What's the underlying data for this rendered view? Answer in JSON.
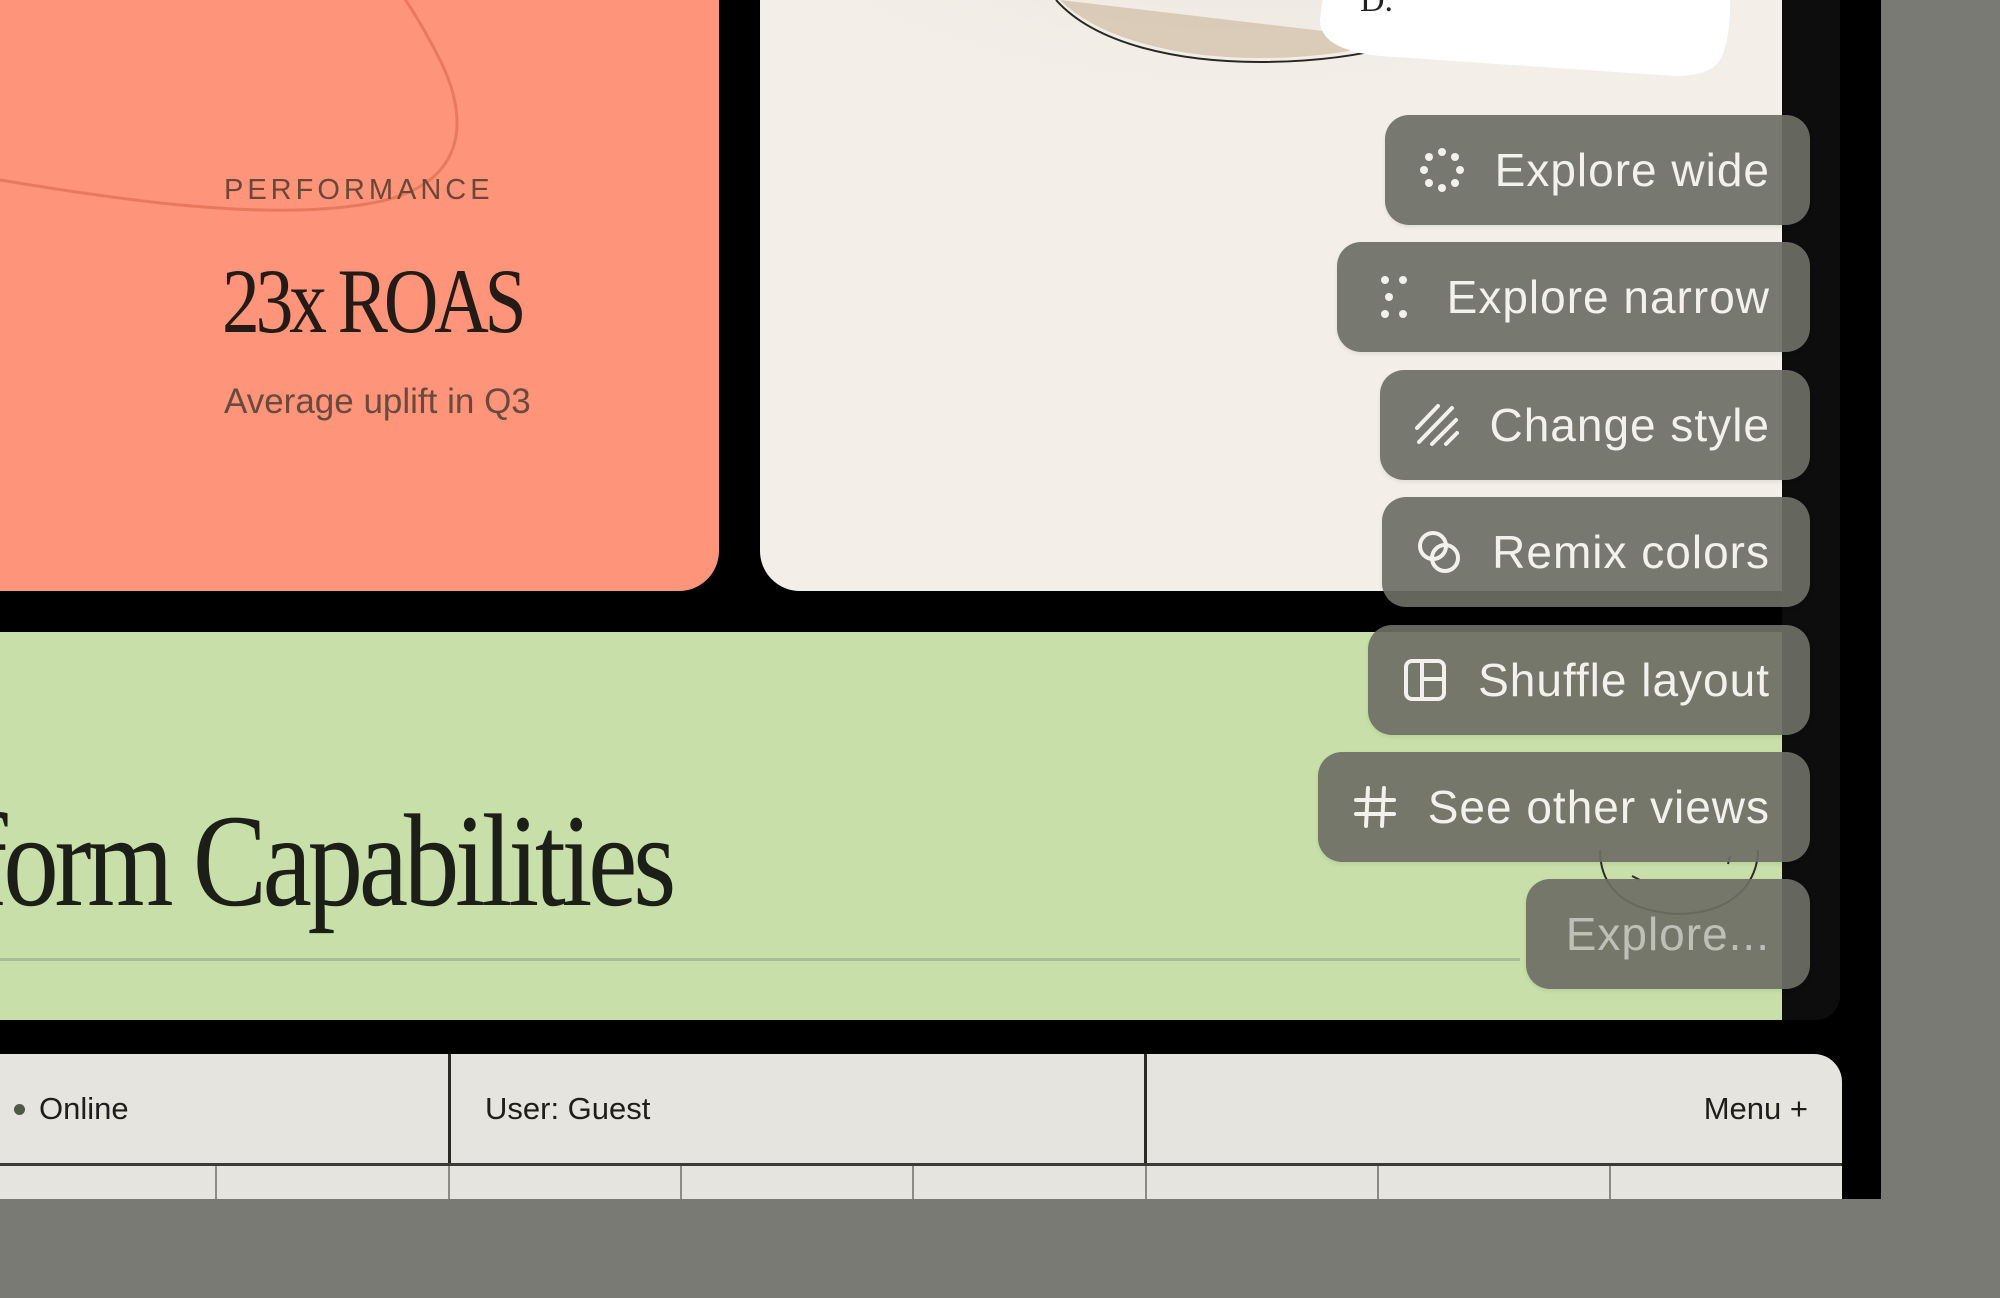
{
  "performance_card": {
    "eyebrow": "PERFORMANCE",
    "metric": "23x ROAS",
    "caption": "Average uplift in Q3"
  },
  "image_card": {
    "label_fragment": "D."
  },
  "capabilities": {
    "title": "tform Capabilities"
  },
  "menu": [
    {
      "label": "Explore wide",
      "icon": "dots-wide-icon"
    },
    {
      "label": "Explore narrow",
      "icon": "dots-narrow-icon"
    },
    {
      "label": "Change style",
      "icon": "hatch-icon"
    },
    {
      "label": "Remix colors",
      "icon": "overlapping-circles-icon"
    },
    {
      "label": "Shuffle layout",
      "icon": "layout-grid-icon"
    },
    {
      "label": "See other views",
      "icon": "hash-icon"
    },
    {
      "label": "Explore..."
    }
  ],
  "statusbar": {
    "status": "Online",
    "user": "User: Guest",
    "menu": "Menu +"
  },
  "colors": {
    "performance_bg": "#fe9479",
    "image_card_bg": "#f3efe8",
    "green_band": "#c8dfa9",
    "menu_button_bg": "#6c6e64",
    "statusbar_bg": "#e6e4df"
  }
}
